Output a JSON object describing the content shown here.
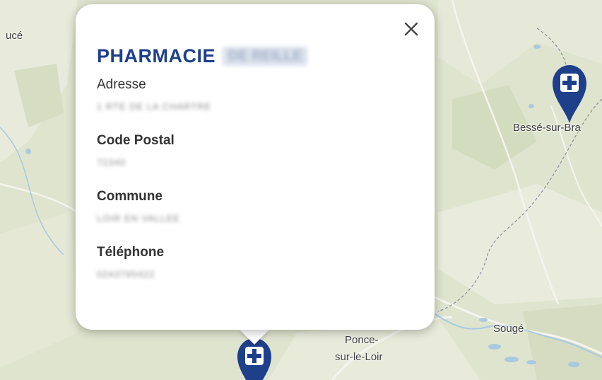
{
  "map": {
    "labels": {
      "uce": "ucé",
      "besse": "Bessé-sur-Bra",
      "pance_line1": "Ponce-",
      "pance_line2": "sur-le-Loir",
      "souge": "Sougé"
    },
    "colors": {
      "land": "#dfe4cf",
      "land_light": "#e9ecdc",
      "water": "#a9c9e0",
      "marker": "#1e3f8a"
    },
    "markers": [
      "pharmacy-marker-besse",
      "pharmacy-marker-selected"
    ]
  },
  "popup": {
    "title": "PHARMACIE",
    "title_redacted": "DE REILLE",
    "fields": [
      {
        "label": "Adresse",
        "value": "1 RTE DE LA CHARTRE"
      },
      {
        "label": "Code Postal",
        "value": "72340"
      },
      {
        "label": "Commune",
        "value": "LOIR EN VALLEE"
      },
      {
        "label": "Téléphone",
        "value": "0243795422"
      }
    ],
    "close_icon": "close-icon"
  }
}
